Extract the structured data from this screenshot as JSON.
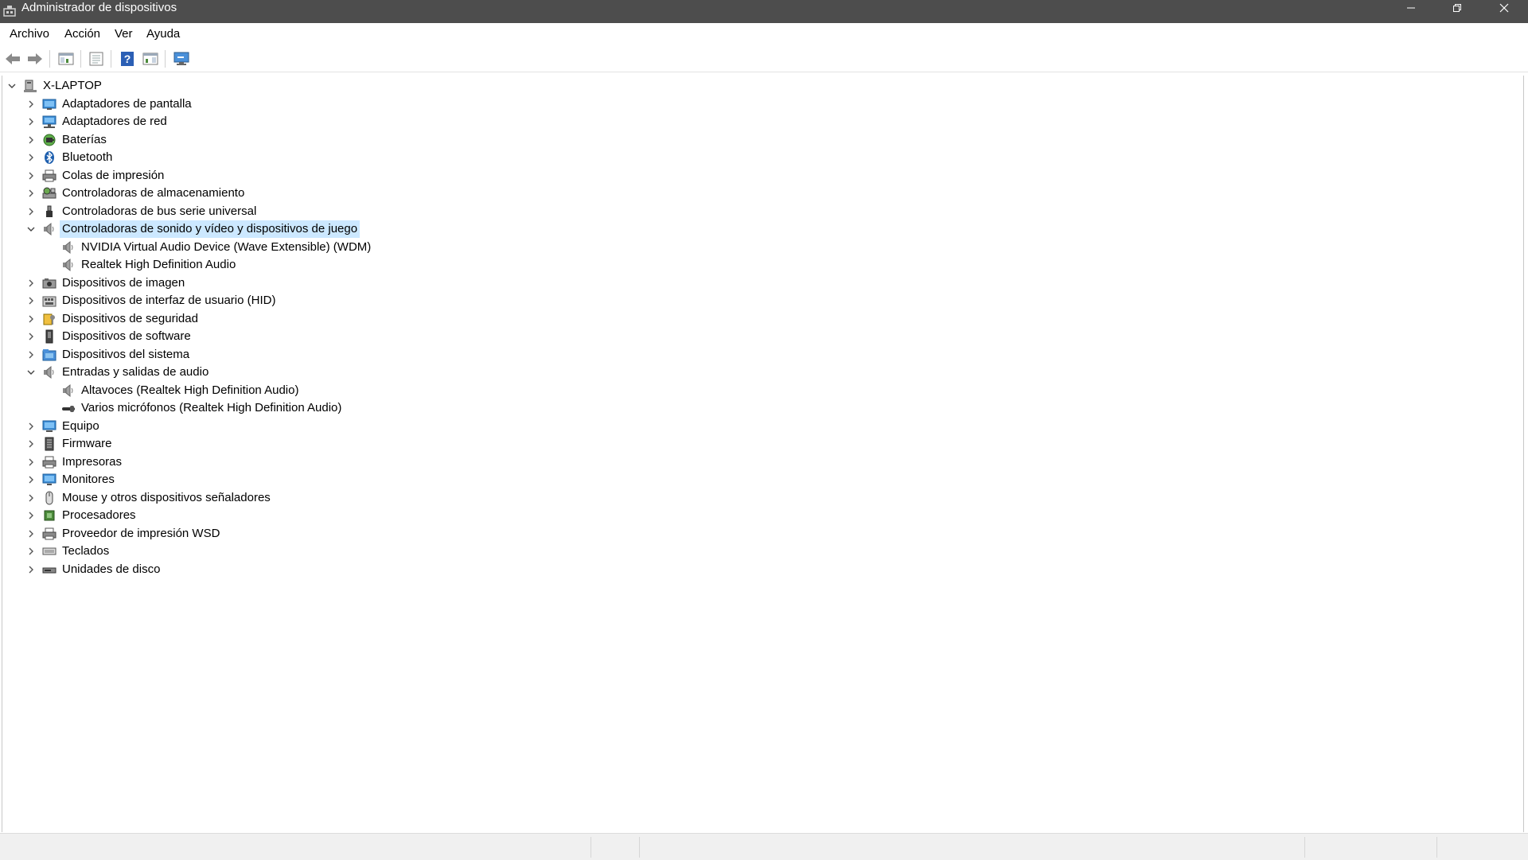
{
  "window": {
    "title": "Administrador de dispositivos"
  },
  "menu": [
    "Archivo",
    "Acción",
    "Ver",
    "Ayuda"
  ],
  "toolbar": [
    "back-icon",
    "forward-icon",
    "show-hide-console-tree-icon",
    "properties-icon",
    "help-icon",
    "action-pane-icon",
    "scan-hardware-icon"
  ],
  "tree": {
    "root": "X-LAPTOP",
    "categories": [
      {
        "label": "Adaptadores de pantalla",
        "icon": "display-adapter-icon",
        "expanded": false
      },
      {
        "label": "Adaptadores de red",
        "icon": "network-adapter-icon",
        "expanded": false
      },
      {
        "label": "Baterías",
        "icon": "battery-icon",
        "expanded": false
      },
      {
        "label": "Bluetooth",
        "icon": "bluetooth-icon",
        "expanded": false
      },
      {
        "label": "Colas de impresión",
        "icon": "print-queue-icon",
        "expanded": false
      },
      {
        "label": "Controladoras de almacenamiento",
        "icon": "storage-controller-icon",
        "expanded": false
      },
      {
        "label": "Controladoras de bus serie universal",
        "icon": "usb-icon",
        "expanded": false
      },
      {
        "label": "Controladoras de sonido y vídeo y dispositivos de juego",
        "icon": "speaker-icon",
        "expanded": true,
        "selected": true,
        "children": [
          {
            "label": "NVIDIA Virtual Audio Device (Wave Extensible) (WDM)",
            "icon": "speaker-icon"
          },
          {
            "label": "Realtek High Definition Audio",
            "icon": "speaker-icon"
          }
        ]
      },
      {
        "label": "Dispositivos de imagen",
        "icon": "camera-icon",
        "expanded": false
      },
      {
        "label": "Dispositivos de interfaz de usuario (HID)",
        "icon": "hid-icon",
        "expanded": false
      },
      {
        "label": "Dispositivos de seguridad",
        "icon": "security-key-icon",
        "expanded": false
      },
      {
        "label": "Dispositivos de software",
        "icon": "software-device-icon",
        "expanded": false
      },
      {
        "label": "Dispositivos del sistema",
        "icon": "system-folder-icon",
        "expanded": false
      },
      {
        "label": "Entradas y salidas de audio",
        "icon": "speaker-icon",
        "expanded": true,
        "children": [
          {
            "label": "Altavoces (Realtek High Definition Audio)",
            "icon": "speaker-icon"
          },
          {
            "label": "Varios micrófonos (Realtek High Definition Audio)",
            "icon": "microphone-icon"
          }
        ]
      },
      {
        "label": "Equipo",
        "icon": "computer-icon",
        "expanded": false
      },
      {
        "label": "Firmware",
        "icon": "firmware-icon",
        "expanded": false
      },
      {
        "label": "Impresoras",
        "icon": "printer-icon",
        "expanded": false
      },
      {
        "label": "Monitores",
        "icon": "monitor-icon",
        "expanded": false
      },
      {
        "label": "Mouse y otros dispositivos señaladores",
        "icon": "mouse-icon",
        "expanded": false
      },
      {
        "label": "Procesadores",
        "icon": "processor-icon",
        "expanded": false
      },
      {
        "label": "Proveedor de impresión WSD",
        "icon": "printer-icon",
        "expanded": false
      },
      {
        "label": "Teclados",
        "icon": "keyboard-icon",
        "expanded": false
      },
      {
        "label": "Unidades de disco",
        "icon": "disk-drive-icon",
        "expanded": false
      }
    ]
  },
  "colors": {
    "titlebar": "#4d4d4d",
    "selection": "#cce8ff",
    "statusbar": "#f0f0f0"
  }
}
